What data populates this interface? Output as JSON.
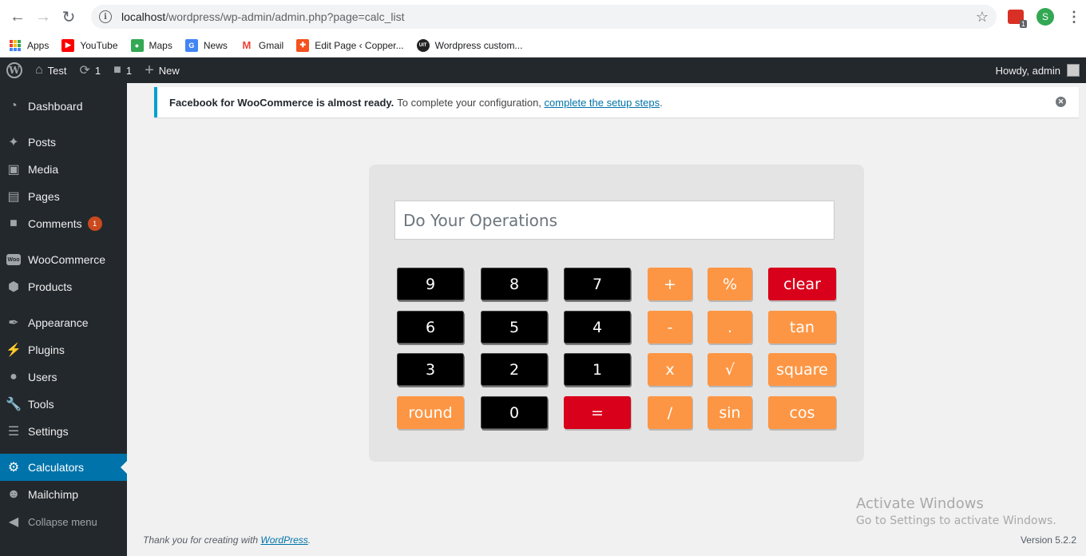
{
  "browser": {
    "url_host": "localhost",
    "url_path": "/wordpress/wp-admin/admin.php?page=calc_list",
    "profile_initial": "S",
    "ext_badge": "1",
    "bookmarks": [
      {
        "label": "Apps",
        "icon": "apps-grid-icon"
      },
      {
        "label": "YouTube",
        "icon": "youtube-icon",
        "color": "#ff0000"
      },
      {
        "label": "Maps",
        "icon": "maps-icon",
        "color": "#34a853"
      },
      {
        "label": "News",
        "icon": "news-icon",
        "color": "#4285f4"
      },
      {
        "label": "Gmail",
        "icon": "gmail-icon",
        "color": "#ea4335"
      },
      {
        "label": "Edit Page ‹ Copper...",
        "icon": "joomla-icon",
        "color": "#f4511e"
      },
      {
        "label": "Wordpress custom...",
        "icon": "uit-icon",
        "color": "#222222"
      }
    ]
  },
  "adminbar": {
    "site_name": "Test",
    "updates_count": "1",
    "comments_count": "1",
    "new_label": "New",
    "howdy": "Howdy, admin"
  },
  "sidebar": {
    "items": [
      {
        "label": "Dashboard",
        "icon": "dashboard-icon"
      },
      {
        "label": "Posts",
        "icon": "pushpin-icon"
      },
      {
        "label": "Media",
        "icon": "media-icon"
      },
      {
        "label": "Pages",
        "icon": "pages-icon"
      },
      {
        "label": "Comments",
        "icon": "comments-icon",
        "badge": "1"
      },
      {
        "label": "WooCommerce",
        "icon": "woocommerce-icon"
      },
      {
        "label": "Products",
        "icon": "products-icon"
      },
      {
        "label": "Appearance",
        "icon": "appearance-icon"
      },
      {
        "label": "Plugins",
        "icon": "plugins-icon"
      },
      {
        "label": "Users",
        "icon": "users-icon"
      },
      {
        "label": "Tools",
        "icon": "tools-icon"
      },
      {
        "label": "Settings",
        "icon": "settings-icon"
      },
      {
        "label": "Calculators",
        "icon": "gear-icon",
        "active": true
      },
      {
        "label": "Mailchimp",
        "icon": "mailchimp-icon"
      },
      {
        "label": "Collapse menu",
        "icon": "collapse-icon"
      }
    ]
  },
  "notice": {
    "strong": "Facebook for WooCommerce is almost ready.",
    "text": "To complete your configuration,",
    "link": "complete the setup steps",
    "end": "."
  },
  "calculator": {
    "placeholder": "Do Your Operations",
    "keys": [
      {
        "label": "9",
        "style": "num"
      },
      {
        "label": "8",
        "style": "num"
      },
      {
        "label": "7",
        "style": "num"
      },
      {
        "label": "+",
        "style": "op"
      },
      {
        "label": "%",
        "style": "op"
      },
      {
        "label": "clear",
        "style": "red"
      },
      {
        "label": "6",
        "style": "num"
      },
      {
        "label": "5",
        "style": "num"
      },
      {
        "label": "4",
        "style": "num"
      },
      {
        "label": "-",
        "style": "op"
      },
      {
        "label": ".",
        "style": "op"
      },
      {
        "label": "tan",
        "style": "op"
      },
      {
        "label": "3",
        "style": "num"
      },
      {
        "label": "2",
        "style": "num"
      },
      {
        "label": "1",
        "style": "num"
      },
      {
        "label": "x",
        "style": "op"
      },
      {
        "label": "√",
        "style": "op"
      },
      {
        "label": "square",
        "style": "op"
      },
      {
        "label": "round",
        "style": "op"
      },
      {
        "label": "0",
        "style": "num"
      },
      {
        "label": "=",
        "style": "red"
      },
      {
        "label": "/",
        "style": "op"
      },
      {
        "label": "sin",
        "style": "op"
      },
      {
        "label": "cos",
        "style": "op"
      }
    ]
  },
  "footer": {
    "thanks_prefix": "Thank you for creating with",
    "thanks_link": "WordPress",
    "thanks_suffix": ".",
    "version": "Version 5.2.2"
  },
  "watermark": {
    "line1": "Activate Windows",
    "line2": "Go to Settings to activate Windows."
  }
}
